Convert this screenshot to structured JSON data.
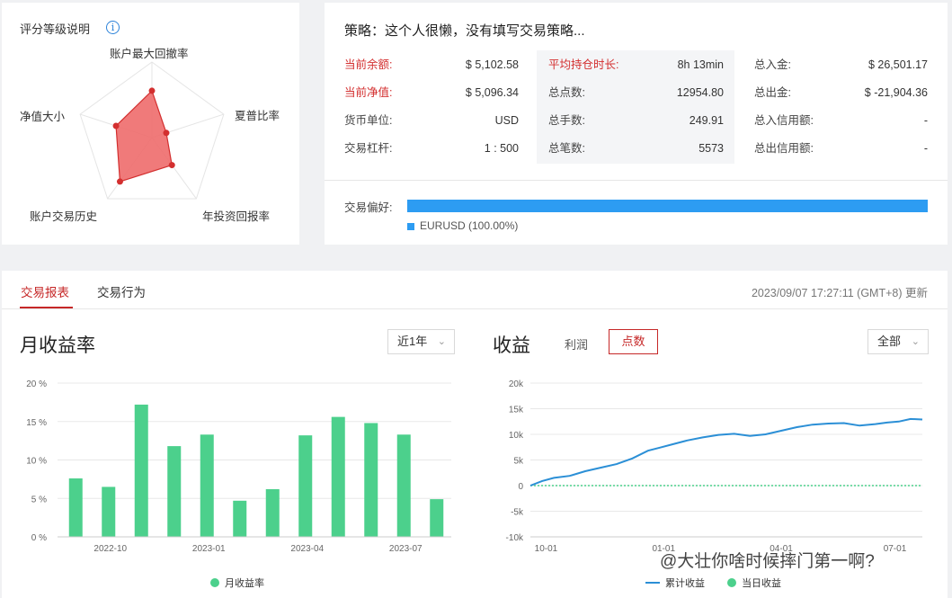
{
  "radar": {
    "title": "评分等级说明",
    "info_icon": "i",
    "axes": [
      "账户最大回撤率",
      "夏普比率",
      "年投资回报率",
      "账户交易历史",
      "净值大小"
    ],
    "scores": [
      0.62,
      0.2,
      0.45,
      0.72,
      0.5
    ],
    "fill_color": "#ee6b6b",
    "stroke_color": "#d32f2f"
  },
  "strategy": {
    "title": "策略：这个人很懒，没有填写交易策略...",
    "col1": [
      {
        "label": "当前余额:",
        "value": "$ 5,102.58",
        "red": true
      },
      {
        "label": "当前净值:",
        "value": "$ 5,096.34",
        "red": true
      },
      {
        "label": "货币单位:",
        "value": "USD",
        "red": false
      },
      {
        "label": "交易杠杆:",
        "value": "1 : 500",
        "red": false
      }
    ],
    "col2": [
      {
        "label": "平均持仓时长:",
        "value": "8h 13min",
        "red": true
      },
      {
        "label": "总点数:",
        "value": "12954.80",
        "red": false
      },
      {
        "label": "总手数:",
        "value": "249.91",
        "red": false
      },
      {
        "label": "总笔数:",
        "value": "5573",
        "red": false
      }
    ],
    "col3": [
      {
        "label": "总入金:",
        "value": "$ 26,501.17",
        "red": false
      },
      {
        "label": "总出金:",
        "value": "$ -21,904.36",
        "red": false
      },
      {
        "label": "总入信用额:",
        "value": "-",
        "red": false
      },
      {
        "label": "总出信用额:",
        "value": "-",
        "red": false
      }
    ],
    "preference_label": "交易偏好:",
    "preference_item": "EURUSD (100.00%)",
    "preference_pct": 100,
    "accent": "#2d9cf2"
  },
  "report": {
    "tabs": [
      "交易报表",
      "交易行为"
    ],
    "active_tab": 0,
    "updated": "2023/09/07 17:27:11 (GMT+8) 更新",
    "monthly": {
      "title": "月收益率",
      "range_select": "近1年",
      "legend": "月收益率"
    },
    "profit": {
      "title": "收益",
      "toggle_profit": "利润",
      "toggle_points": "点数",
      "range_select": "全部",
      "legend_cumulative": "累计收益",
      "legend_daily": "当日收益"
    }
  },
  "watermark": "@大壮你啥时候摔门第一啊?",
  "chart_data": [
    {
      "type": "bar",
      "categories": [
        "2022-09",
        "2022-10",
        "2022-11",
        "2022-12",
        "2023-01",
        "2023-02",
        "2023-03",
        "2023-04",
        "2023-05",
        "2023-06",
        "2023-07",
        "2023-08"
      ],
      "x_tick_labels": [
        "2022-10",
        "2023-01",
        "2023-04",
        "2023-07"
      ],
      "x_tick_indices": [
        1,
        4,
        7,
        10
      ],
      "series": [
        {
          "name": "月收益率",
          "values": [
            7.6,
            6.5,
            17.2,
            11.8,
            13.3,
            4.7,
            6.2,
            13.2,
            15.6,
            14.8,
            13.3,
            4.9
          ]
        }
      ],
      "yticks": [
        "0 %",
        "5 %",
        "10 %",
        "15 %",
        "20 %"
      ],
      "ylim": [
        0,
        20
      ],
      "color": "#4cd08c"
    },
    {
      "type": "line",
      "yticks": [
        "-10k",
        "-5k",
        "0",
        "5k",
        "10k",
        "15k",
        "20k"
      ],
      "ylim": [
        -10000,
        20000
      ],
      "x_tick_labels": [
        "10-01",
        "01-01",
        "04-01",
        "07-01"
      ],
      "x_tick_positions": [
        0.04,
        0.34,
        0.64,
        0.93
      ],
      "series": [
        {
          "name": "累计收益",
          "color": "#2b8fd6",
          "x": [
            0,
            0.03,
            0.06,
            0.1,
            0.14,
            0.18,
            0.22,
            0.26,
            0.3,
            0.33,
            0.36,
            0.4,
            0.44,
            0.48,
            0.52,
            0.56,
            0.6,
            0.64,
            0.68,
            0.72,
            0.76,
            0.8,
            0.84,
            0.88,
            0.91,
            0.94,
            0.97,
            1.0
          ],
          "y": [
            0,
            900,
            1500,
            1900,
            2800,
            3500,
            4200,
            5300,
            6800,
            7400,
            8000,
            8800,
            9400,
            9900,
            10100,
            9700,
            10000,
            10700,
            11400,
            11900,
            12100,
            12200,
            11700,
            12000,
            12300,
            12500,
            13000,
            12900
          ]
        },
        {
          "name": "当日收益",
          "color": "#4cd08c",
          "x": [
            0,
            1
          ],
          "y": [
            0,
            0
          ]
        }
      ],
      "ytick_labels_units": "points"
    }
  ]
}
